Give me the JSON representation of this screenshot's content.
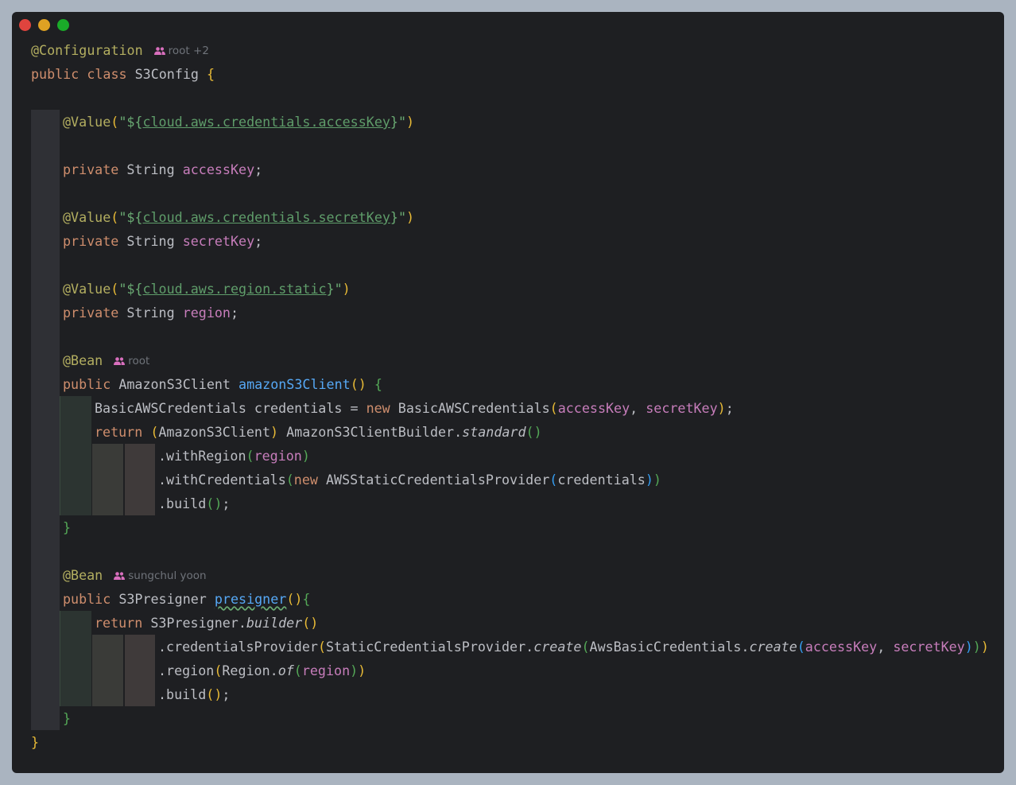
{
  "window": {
    "controls": [
      "close",
      "minimize",
      "maximize"
    ],
    "colors": {
      "close": "#e0443e",
      "minimize": "#dea123",
      "maximize": "#1aab29"
    }
  },
  "editor": {
    "annotation_configuration": "@Configuration",
    "author_config": "root +2",
    "class_decl": {
      "public": "public",
      "class": "class",
      "name": "S3Config",
      "brace": "{"
    },
    "value1": {
      "ann": "@Value",
      "open": "(\"${",
      "prop": "cloud.aws.credentials.accessKey",
      "close": "}\")"
    },
    "field1": {
      "private": "private",
      "type": "String",
      "name": "accessKey",
      "semi": ";"
    },
    "value2": {
      "ann": "@Value",
      "open": "(\"${",
      "prop": "cloud.aws.credentials.secretKey",
      "close": "}\")"
    },
    "field2": {
      "private": "private",
      "type": "String",
      "name": "secretKey",
      "semi": ";"
    },
    "value3": {
      "ann": "@Value",
      "open": "(\"${",
      "prop": "cloud.aws.region.static",
      "close": "}\")"
    },
    "field3": {
      "private": "private",
      "type": "String",
      "name": "region",
      "semi": ";"
    },
    "bean1": {
      "ann": "@Bean",
      "author": "root"
    },
    "method1": {
      "public": "public",
      "type": "AmazonS3Client",
      "name": "amazonS3Client",
      "parens": "()",
      "brace": "{"
    },
    "m1_line1": {
      "type": "BasicAWSCredentials credentials = ",
      "new": "new",
      "ctor": "BasicAWSCredentials",
      "open": "(",
      "arg1": "accessKey",
      "comma": ", ",
      "arg2": "secretKey",
      "close": ")",
      "semi": ";"
    },
    "m1_line2": {
      "return": "return",
      "cast_open": "(",
      "cast_type": "AmazonS3Client",
      "cast_close": ")",
      "builder": "AmazonS3ClientBuilder.",
      "standard": "standard",
      "parens": "()"
    },
    "m1_line3": {
      "call": ".withRegion",
      "open": "(",
      "arg": "region",
      "close": ")"
    },
    "m1_line4": {
      "call": ".withCredentials",
      "open": "(",
      "new": "new",
      "ctor": "AWSStaticCredentialsProvider",
      "open2": "(",
      "arg": "credentials",
      "close2": ")",
      "close": ")"
    },
    "m1_line5": {
      "call": ".build",
      "parens": "()",
      "semi": ";"
    },
    "m1_close": "}",
    "bean2": {
      "ann": "@Bean",
      "author": "sungchul yoon"
    },
    "method2": {
      "public": "public",
      "type": "S3Presigner",
      "name": "presigner",
      "parens": "()",
      "brace": "{"
    },
    "m2_line1": {
      "return": "return",
      "builder": "S3Presigner.",
      "method": "builder",
      "parens": "()"
    },
    "m2_line2": {
      "call": ".credentialsProvider",
      "open": "(",
      "cls": "StaticCredentialsProvider.",
      "create": "create",
      "open2": "(",
      "cls2": "AwsBasicCredentials.",
      "create2": "create",
      "open3": "(",
      "arg1": "accessKey",
      "comma": ", ",
      "arg2": "secretKey",
      "close3": ")",
      "close2": ")",
      "close": ")"
    },
    "m2_line3": {
      "call": ".region",
      "open": "(",
      "cls": "Region.",
      "of": "of",
      "open2": "(",
      "arg": "region",
      "close2": ")",
      "close": ")"
    },
    "m2_line4": {
      "call": ".build",
      "parens": "()",
      "semi": ";"
    },
    "m2_close": "}",
    "class_close": "}"
  },
  "syntax_colors": {
    "keyword": "#cf8e6d",
    "annotation": "#b3ae60",
    "string": "#6aab73",
    "field": "#c77dbb",
    "method": "#56a8f5",
    "text": "#bcbec4",
    "bracket_yellow": "#e8ba36",
    "bracket_green": "#54a857",
    "bracket_blue": "#359ff4"
  }
}
